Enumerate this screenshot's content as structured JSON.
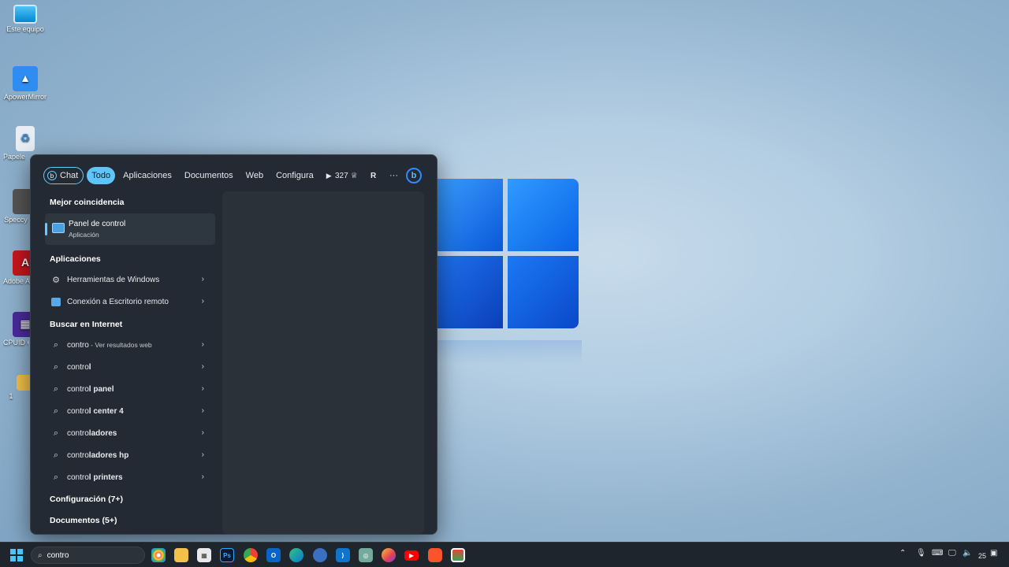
{
  "desktop": {
    "icons": [
      {
        "label": "Este equipo"
      },
      {
        "label": "ApowerMirror"
      },
      {
        "label": "Papelera de reciclaje"
      },
      {
        "label": "Speccy"
      },
      {
        "label": "Adobe Acrobat"
      },
      {
        "label": "CPUID CPU-Z"
      },
      {
        "label": "1"
      }
    ]
  },
  "search_panel": {
    "tabs": [
      {
        "label": "Chat"
      },
      {
        "label": "Todo"
      },
      {
        "label": "Aplicaciones"
      },
      {
        "label": "Documentos"
      },
      {
        "label": "Web"
      },
      {
        "label": "Configura"
      }
    ],
    "points": "327",
    "avatar_letter": "R",
    "more": "···",
    "bing_letter": "b",
    "best_match_heading": "Mejor coincidencia",
    "best_match": {
      "title": "Panel de control",
      "subtitle": "Aplicación"
    },
    "apps_heading": "Aplicaciones",
    "apps": [
      {
        "label": "Herramientas de Windows"
      },
      {
        "label": "Conexión a Escritorio remoto"
      }
    ],
    "web_heading": "Buscar en Internet",
    "web_results": [
      {
        "prefix": "contro",
        "bold": "",
        "suffix": " - Ver resultados web"
      },
      {
        "prefix": "contro",
        "bold": "l",
        "suffix": ""
      },
      {
        "prefix": "contro",
        "bold": "l panel",
        "suffix": ""
      },
      {
        "prefix": "contro",
        "bold": "l center 4",
        "suffix": ""
      },
      {
        "prefix": "contro",
        "bold": "ladores",
        "suffix": ""
      },
      {
        "prefix": "contro",
        "bold": "ladores hp",
        "suffix": ""
      },
      {
        "prefix": "contro",
        "bold": "l printers",
        "suffix": ""
      }
    ],
    "settings_heading": "Configuración (7+)",
    "documents_heading": "Documentos (5+)"
  },
  "taskbar": {
    "search_value": "contro",
    "apps": [
      "Ps"
    ],
    "clock": "25"
  },
  "colors": {
    "accent": "#60cdff",
    "panel": "#232a33"
  }
}
